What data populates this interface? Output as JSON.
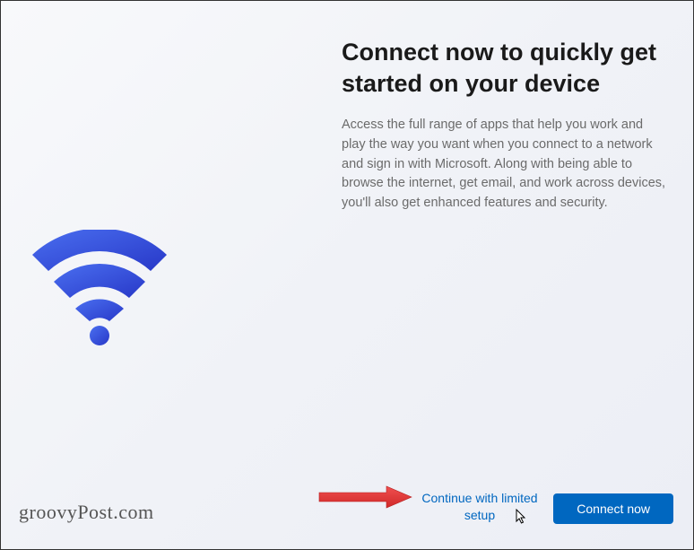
{
  "main": {
    "title": "Connect now to quickly get started on your device",
    "description": "Access the full range of apps that help you work and play the way you want when you connect to a network and sign in with Microsoft. Along with being able to browse the internet, get email, and work across devices, you'll also get enhanced features and security."
  },
  "footer": {
    "watermark": "groovyPost.com",
    "limited_setup_label": "Continue with limited setup",
    "connect_button_label": "Connect now"
  },
  "colors": {
    "primary_blue": "#0067c0",
    "wifi_gradient_start": "#3b5fe0",
    "wifi_gradient_end": "#2a3dd8",
    "arrow_red": "#e23a3a"
  }
}
